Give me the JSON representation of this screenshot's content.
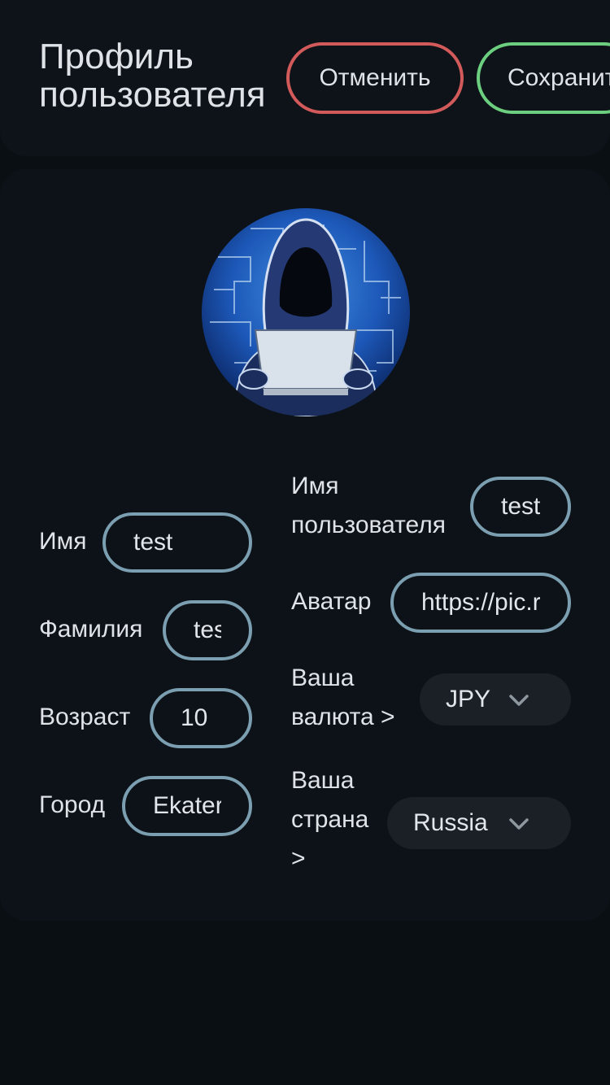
{
  "header": {
    "title": "Профиль пользователя",
    "cancel_label": "Отменить",
    "save_label": "Сохранить"
  },
  "form": {
    "first_name": {
      "label": "Имя",
      "value": "test"
    },
    "last_name": {
      "label": "Фамилия",
      "value": "test"
    },
    "age": {
      "label": "Возраст",
      "value": "10"
    },
    "city": {
      "label": "Город",
      "value": "Ekaterinburg"
    },
    "username": {
      "label": "Имя пользователя",
      "value": "test"
    },
    "avatar": {
      "label": "Аватар",
      "value": "https://pic.re"
    },
    "currency": {
      "label": "Ваша валюта >",
      "value": "JPY"
    },
    "country": {
      "label": "Ваша страна >",
      "value": "Russia"
    }
  },
  "colors": {
    "cancel_border": "#d25a5a",
    "save_border": "#6ccf7f",
    "field_border": "#7b9fb0",
    "background": "#0a0f13"
  },
  "icons": {
    "avatar": "hooded-hacker-avatar",
    "dropdown": "chevron-down-icon"
  }
}
